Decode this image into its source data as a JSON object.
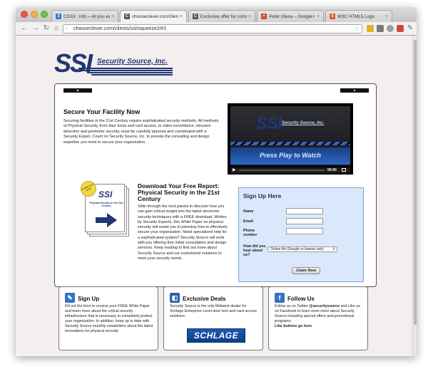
{
  "browser": {
    "tabs": [
      {
        "label": "CSS3 : Info – All you ever ne",
        "favicon_color": "#2f7bd6"
      },
      {
        "label": "chooseclever.com/clients/ss",
        "favicon_color": "#555555"
      },
      {
        "label": "Exclusive offer for commerci",
        "favicon_color": "#555555"
      },
      {
        "label": "Peter Olexa – Google+",
        "favicon_color": "#d44a3a"
      },
      {
        "label": "W3C HTML5 Logo",
        "favicon_color": "#e5532d"
      }
    ],
    "url": "chooseclever.com/clients/ssi/squeeze2/#1"
  },
  "logo": {
    "mark": "SSI",
    "text": "Security Source, Inc."
  },
  "intro": {
    "title": "Secure Your Facility Now",
    "body": "Securing facilities in the 21st Century require sophisticated security methods. All methods of Physical Security, from door locks and card access, to video surveillance, intrusion detection and perimeter security, must be carefully planned and coordinated with a Security Expert. Count on Security Source, Inc. to provide the consulting and design expertise you need to secure your organization."
  },
  "video": {
    "logo_mark": "SSI",
    "logo_text": "Security Source, Inc.",
    "play_text": "Press Play to Watch",
    "time": "00:00"
  },
  "report": {
    "badge": "DOWNLOAD NOW!",
    "cover_logo": "SSI",
    "cover_title": "Physical Security in the 21st Century",
    "title": "Download Your Free Report: Physical Security in the 21st Century",
    "body": "Slide through the next panels to discover how you can gain critical insight into the latest electronic security techniques with a FREE download. Written by Security Experts, this White Paper on physical security will assist you in planning how to effectively secure your organization. Need specialized help for a sophisticated system? Security Source will work with you offering free initial consultation and design services. Keep reading to find out more about Security Source and our customized solutions to meet your security needs."
  },
  "signup": {
    "title": "Sign Up Here",
    "name_label": "Name",
    "email_label": "Email",
    "phone_label": "Phone number",
    "hear_label": "How did you hear about us?",
    "hear_selected": "Online Ad (Google or banner ads)",
    "button": "Claim Now"
  },
  "boxes": {
    "signup": {
      "title": "Sign Up",
      "text": "Fill out the form to receive your FREE White Paper and learn more about the critical security infrastructure that is necessary to completely protect your organization. In addition, keep up to date with Security Source monthly newsletters about the latest innovations for physical security."
    },
    "deals": {
      "title": "Exclusive Deals",
      "text": "Security Source is the only Midwest dealer for Schlage Enterprise Level door lock and card access solutions.",
      "brand": "SCHLAGE"
    },
    "follow": {
      "title": "Follow Us",
      "text_1": "Follow us on Twitter ",
      "handle": "@securitysource",
      "text_2": " and Like us on Facebook to learn even more about Security Source including special offers and promotional programs.",
      "like_note": "Like buttons go here"
    }
  },
  "colors": {
    "brand_navy": "#1f3773",
    "page_bg": "#f5eeee",
    "signup_bg": "#dbe8fb"
  }
}
